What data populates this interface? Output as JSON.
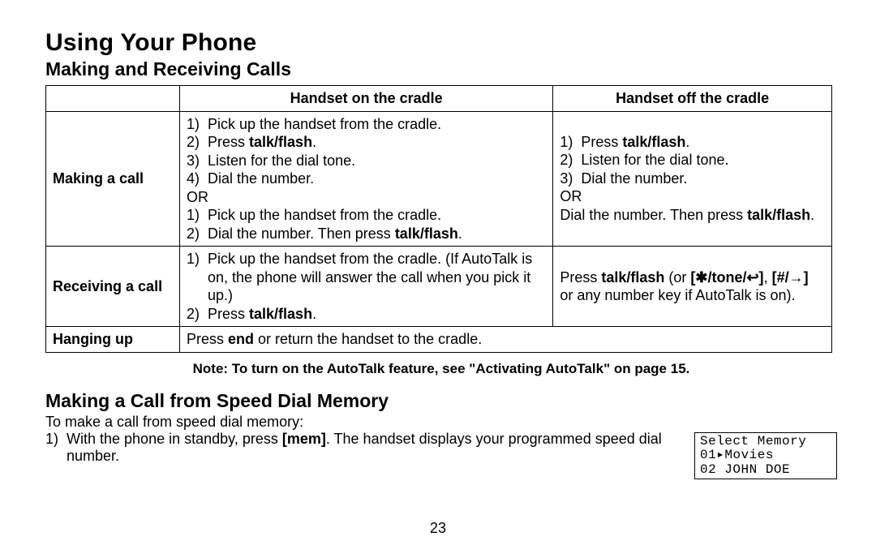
{
  "title": "Using Your Phone",
  "section1": {
    "heading": "Making and Receiving Calls",
    "table": {
      "header": {
        "col1": "",
        "col2": "Handset on the cradle",
        "col3": "Handset off the cradle"
      },
      "rows": {
        "making": {
          "label": "Making a call",
          "onCradle": {
            "listA": [
              {
                "n": "1)",
                "t_pre": "Pick up the handset from the cradle.",
                "t_bold": "",
                "t_post": ""
              },
              {
                "n": "2)",
                "t_pre": "Press ",
                "t_bold": "talk/flash",
                "t_post": "."
              },
              {
                "n": "3)",
                "t_pre": "Listen for the dial tone.",
                "t_bold": "",
                "t_post": ""
              },
              {
                "n": "4)",
                "t_pre": "Dial the number.",
                "t_bold": "",
                "t_post": ""
              }
            ],
            "or": "OR",
            "listB": [
              {
                "n": "1)",
                "t_pre": "Pick up the handset from the cradle.",
                "t_bold": "",
                "t_post": ""
              },
              {
                "n": "2)",
                "t_pre": "Dial the number. Then press ",
                "t_bold": "talk/flash",
                "t_post": "."
              }
            ]
          },
          "offCradle": {
            "listA": [
              {
                "n": "1)",
                "t_pre": "Press ",
                "t_bold": "talk/flash",
                "t_post": "."
              },
              {
                "n": "2)",
                "t_pre": "Listen for the dial tone.",
                "t_bold": "",
                "t_post": ""
              },
              {
                "n": "3)",
                "t_pre": "Dial the number.",
                "t_bold": "",
                "t_post": ""
              }
            ],
            "or": "OR",
            "tail_pre": "Dial the number. Then press ",
            "tail_bold": "talk/flash",
            "tail_post": "."
          }
        },
        "receiving": {
          "label": "Receiving a call",
          "onCradle": {
            "list": [
              {
                "n": "1)",
                "t_pre": "Pick up the handset from the cradle. (If AutoTalk is on, the phone will answer the call when you pick it up.)",
                "t_bold": "",
                "t_post": ""
              },
              {
                "n": "2)",
                "t_pre": "Press ",
                "t_bold": "talk/flash",
                "t_post": "."
              }
            ]
          },
          "offCradle": {
            "p1": "Press ",
            "b1": "talk/flash",
            "p2": " (or ",
            "b2": "[✱/tone/↩]",
            "p3": ", ",
            "b3": "[#/→]",
            "p4": " or any number key if AutoTalk is on)."
          }
        },
        "hangup": {
          "label": "Hanging up",
          "text_pre": "Press ",
          "text_bold": "end",
          "text_post": " or return the handset to the cradle."
        }
      }
    },
    "note": "Note: To turn on the AutoTalk feature, see \"Activating AutoTalk\" on page 15."
  },
  "section2": {
    "heading": "Making a Call from Speed Dial Memory",
    "intro": "To make a call from speed dial memory:",
    "step": {
      "n": "1)",
      "pre": "With the phone in standby, press ",
      "bold": "[mem]",
      "post": ". The handset displays your programmed speed dial number."
    },
    "lcd": {
      "line1": "Select Memory",
      "line2": "01▸Movies",
      "line3": "02 JOHN DOE"
    }
  },
  "pageNumber": "23"
}
